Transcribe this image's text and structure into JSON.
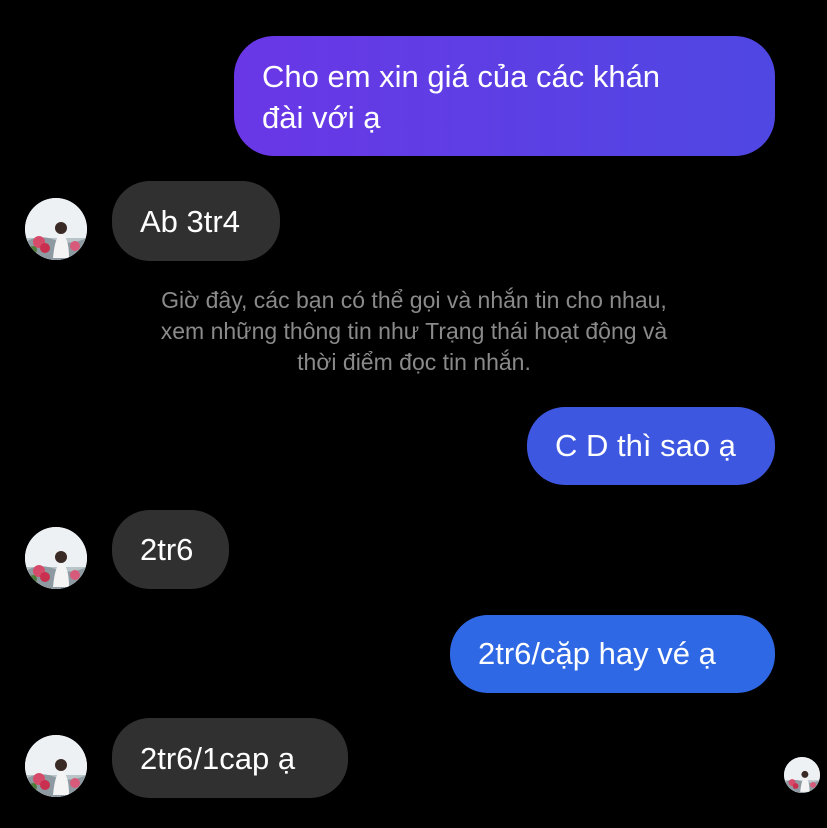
{
  "messages": [
    {
      "id": "m1",
      "direction": "outgoing",
      "lines": [
        "Cho em xin giá của các khán",
        "đài với ạ"
      ]
    },
    {
      "id": "m2",
      "direction": "incoming",
      "text": "Ab 3tr4"
    },
    {
      "id": "m3",
      "direction": "outgoing",
      "text": "C D thì sao ạ"
    },
    {
      "id": "m4",
      "direction": "incoming",
      "text": "2tr6"
    },
    {
      "id": "m5",
      "direction": "outgoing",
      "text": "2tr6/cặp hay vé ạ"
    },
    {
      "id": "m6",
      "direction": "incoming",
      "text": "2tr6/1cap ạ"
    }
  ],
  "system_notice": {
    "lines": [
      "Giờ đây, các bạn có thể gọi và nhắn tin cho nhau,",
      "xem những thông tin như Trạng thái hoạt động và",
      "thời điểm đọc tin nhắn."
    ]
  },
  "colors": {
    "background": "#000000",
    "incoming_bubble": "#303030",
    "outgoing_gradient_start": "#6a37e6",
    "outgoing_gradient_end": "#4f47e3",
    "outgoing_mid": "#3e57e1",
    "outgoing_end": "#2f68e4",
    "notice_text": "#8a8a8a"
  },
  "icons": {
    "contact_avatar": "contact-avatar-photo",
    "seen_indicator": "seen-avatar-photo"
  }
}
